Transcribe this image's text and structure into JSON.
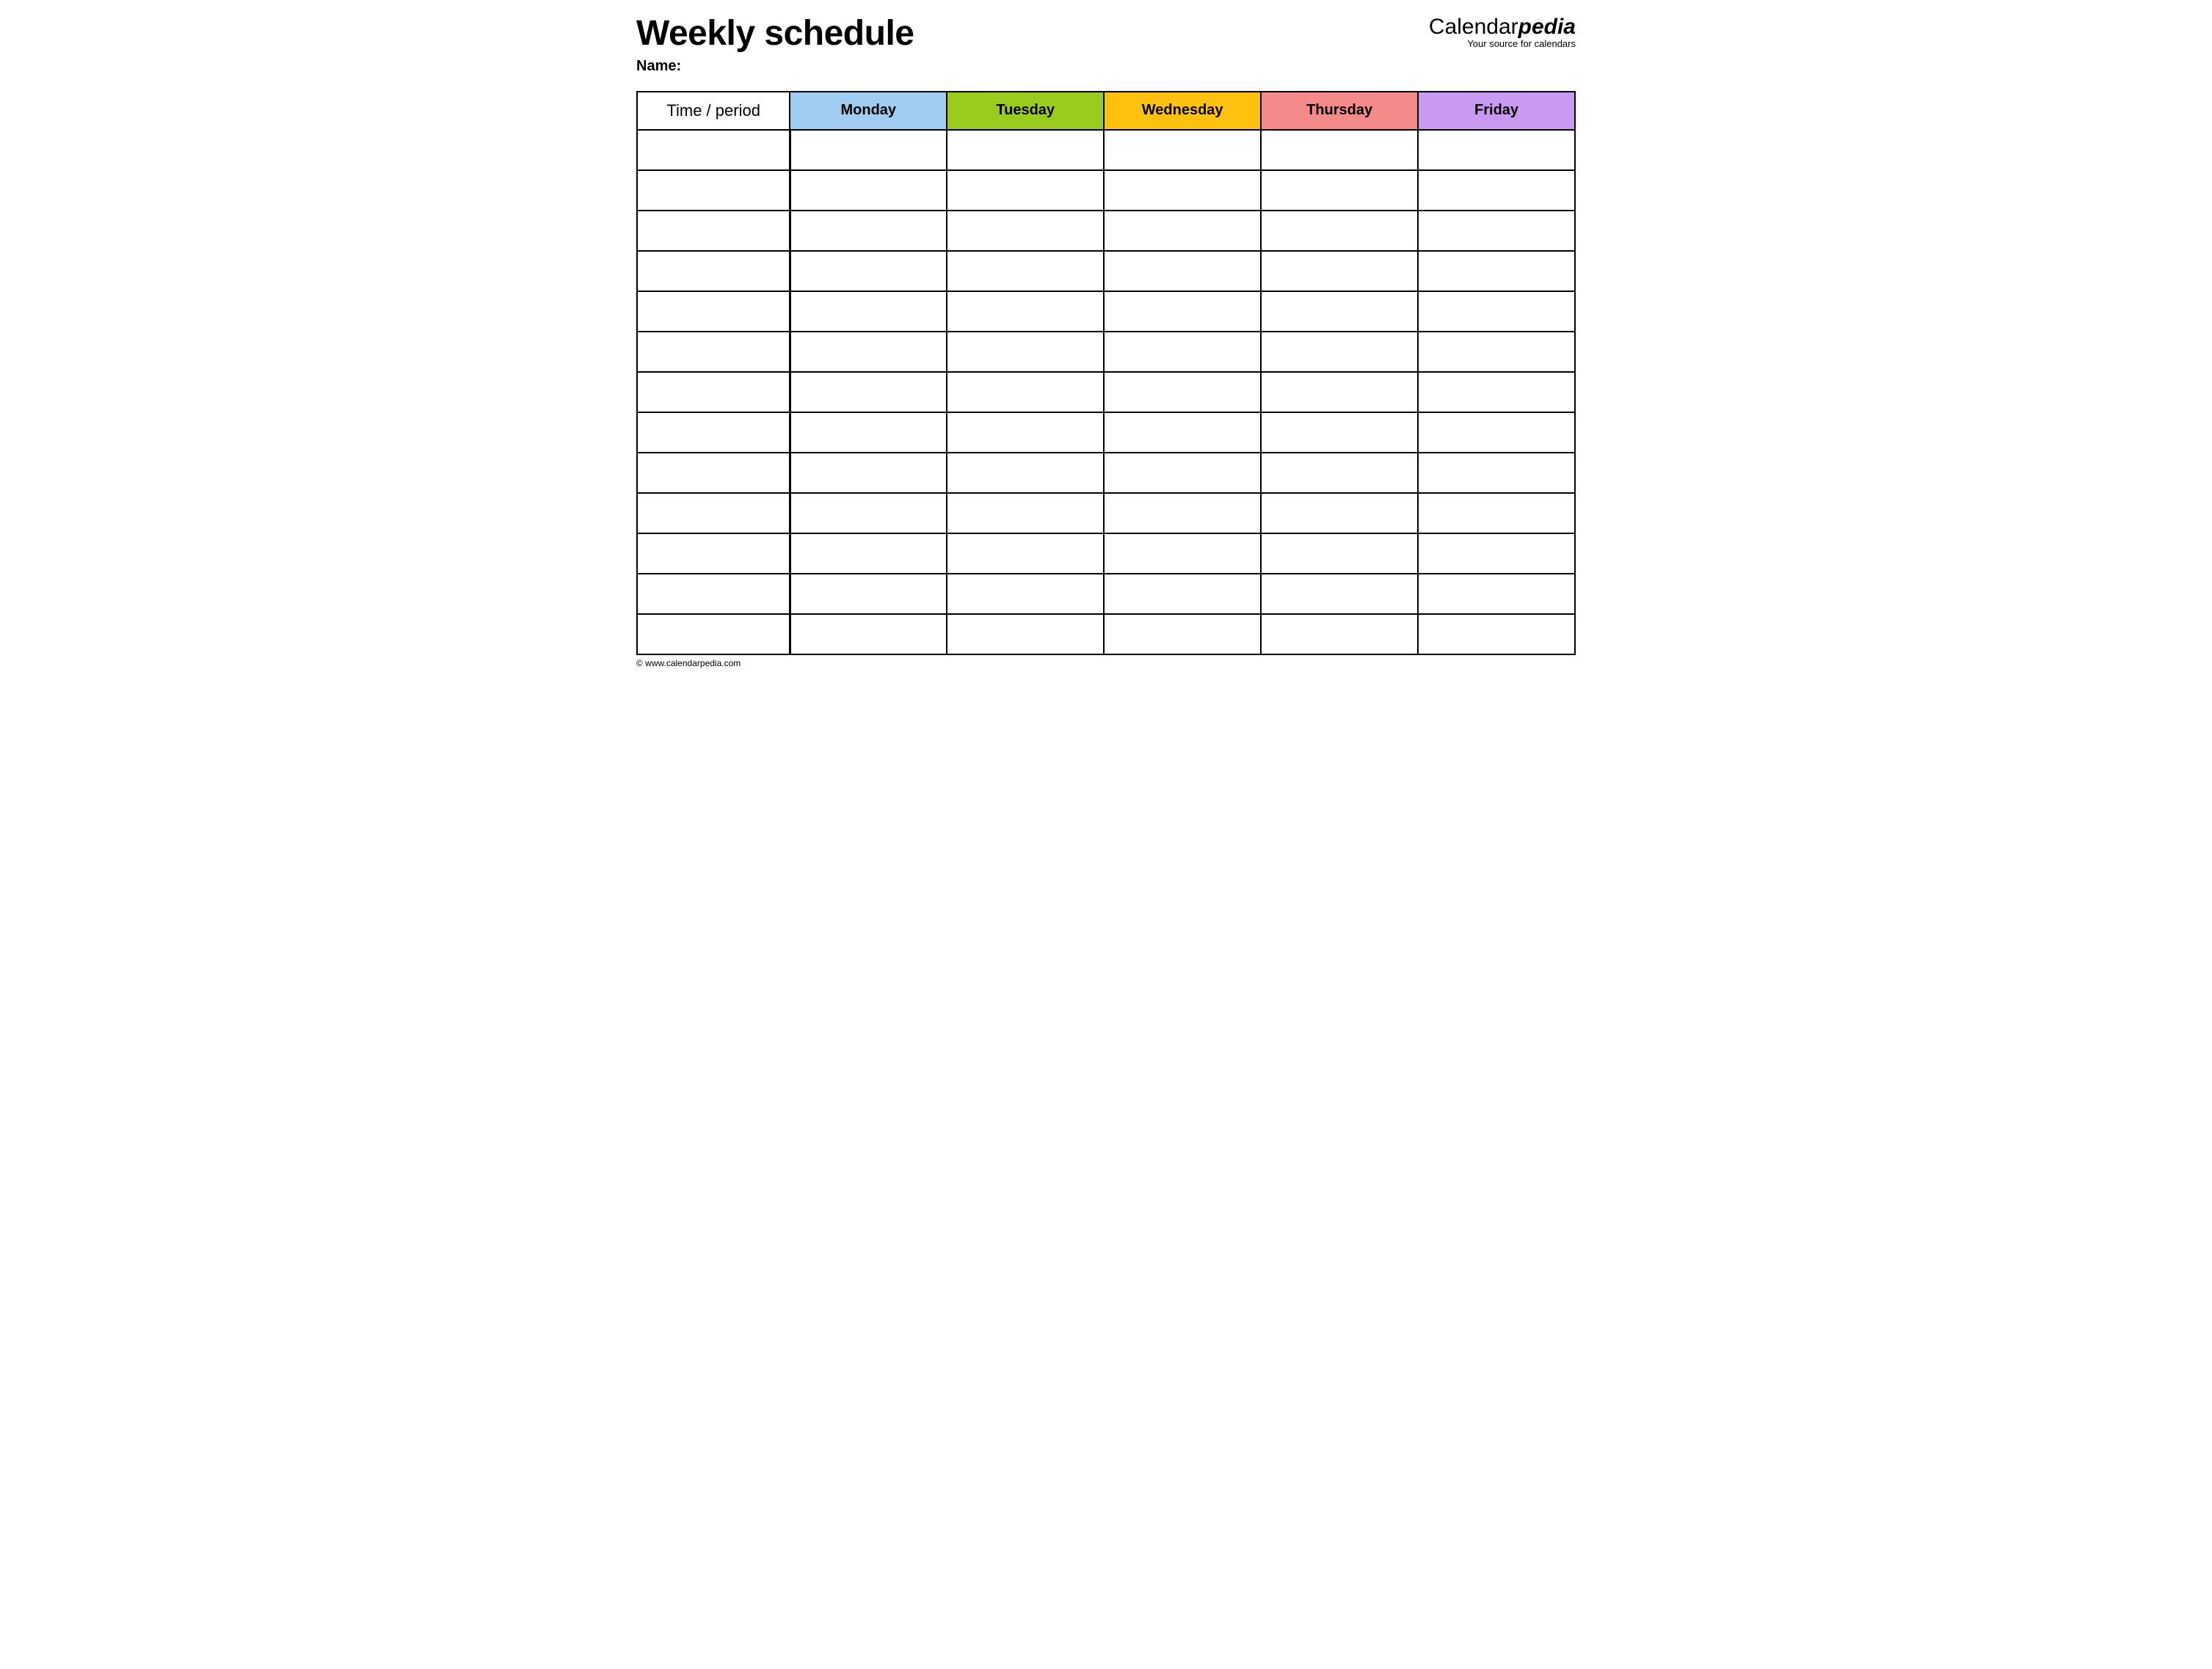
{
  "header": {
    "title": "Weekly schedule",
    "name_label": "Name:",
    "brand_calendar": "Calendar",
    "brand_pedia": "pedia",
    "brand_tagline": "Your source for calendars"
  },
  "table": {
    "time_header": "Time / period",
    "days": [
      {
        "label": "Monday",
        "color": "#9ecdf0"
      },
      {
        "label": "Tuesday",
        "color": "#9acc1f"
      },
      {
        "label": "Wednesday",
        "color": "#fdc20f"
      },
      {
        "label": "Thursday",
        "color": "#f58a8a"
      },
      {
        "label": "Friday",
        "color": "#c99af2"
      }
    ],
    "row_count": 13
  },
  "footer": {
    "copyright": "© www.calendarpedia.com"
  }
}
